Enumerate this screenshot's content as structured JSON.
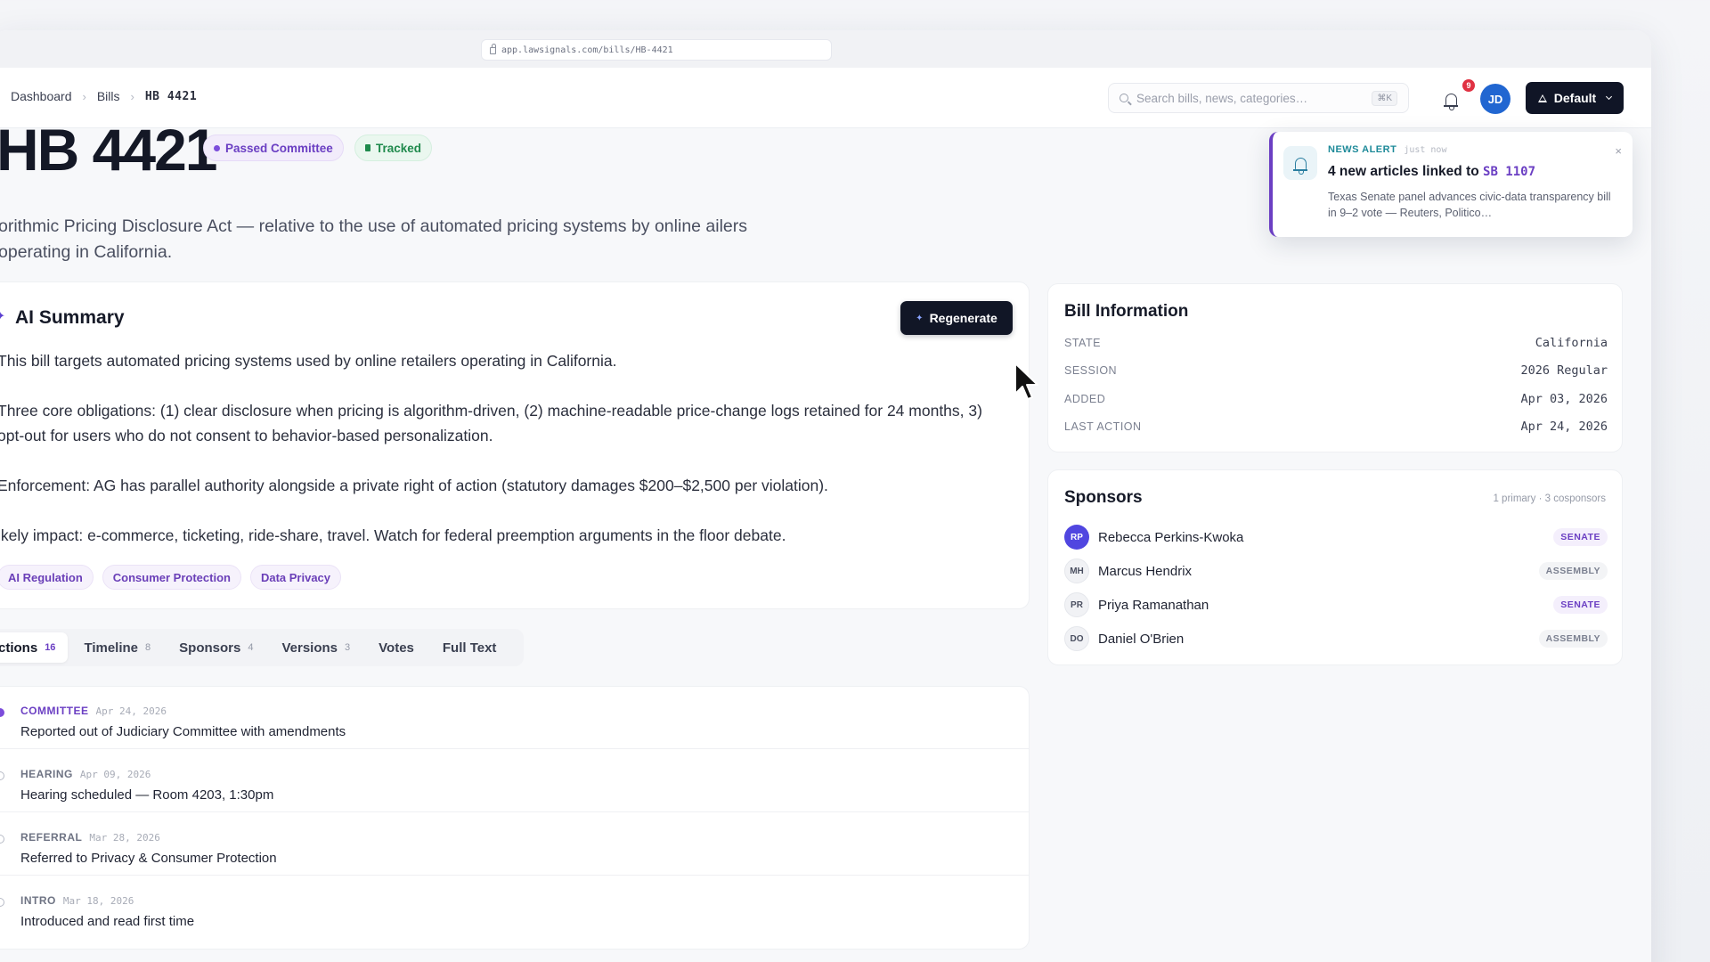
{
  "browser": {
    "url": "app.lawsignals.com/bills/HB-4421"
  },
  "breadcrumb": {
    "items": [
      "Dashboard",
      "Bills",
      "HB 4421"
    ]
  },
  "search": {
    "placeholder": "Search bills, news, categories…",
    "shortcut": "⌘K"
  },
  "notifications": {
    "count": "9"
  },
  "user": {
    "initials": "JD"
  },
  "workspace": {
    "label": "Default"
  },
  "bill": {
    "number": "HB 4421",
    "status": "Passed Committee",
    "tracked": "Tracked",
    "subtitle": "orithmic Pricing Disclosure Act — relative to the use of automated pricing systems by online ailers operating in California."
  },
  "ai_summary": {
    "title": "AI Summary",
    "regenerate_label": "Regenerate",
    "paragraphs": [
      "This bill targets automated pricing systems used by online retailers operating in California.",
      "Three core obligations: (1) clear disclosure when pricing is algorithm-driven, (2) machine-readable price-change logs retained for 24 months, 3) opt-out for users who do not consent to behavior-based personalization.",
      "Enforcement: AG has parallel authority alongside a private right of action (statutory damages $200–$2,500 per violation).",
      "ikely impact: e-commerce, ticketing, ride-share, travel. Watch for federal preemption arguments in the floor debate."
    ],
    "tags": [
      "AI Regulation",
      "Consumer Protection",
      "Data Privacy"
    ]
  },
  "tabs": [
    {
      "label": "ctions",
      "count": "16"
    },
    {
      "label": "Timeline",
      "count": "8"
    },
    {
      "label": "Sponsors",
      "count": "4"
    },
    {
      "label": "Versions",
      "count": "3"
    },
    {
      "label": "Votes",
      "count": ""
    },
    {
      "label": "Full Text",
      "count": ""
    }
  ],
  "timeline": [
    {
      "kind": "COMMITTEE",
      "date": "Apr 24, 2026",
      "text": "Reported out of Judiciary Committee with amendments"
    },
    {
      "kind": "HEARING",
      "date": "Apr 09, 2026",
      "text": "Hearing scheduled — Room 4203, 1:30pm"
    },
    {
      "kind": "REFERRAL",
      "date": "Mar 28, 2026",
      "text": "Referred to Privacy & Consumer Protection"
    },
    {
      "kind": "INTRO",
      "date": "Mar 18, 2026",
      "text": "Introduced and read first time"
    }
  ],
  "bill_info": {
    "title": "Bill Information",
    "rows": [
      {
        "key": "STATE",
        "value": "California"
      },
      {
        "key": "SESSION",
        "value": "2026 Regular"
      },
      {
        "key": "ADDED",
        "value": "Apr 03, 2026"
      },
      {
        "key": "LAST ACTION",
        "value": "Apr 24, 2026"
      }
    ]
  },
  "sponsors": {
    "title": "Sponsors",
    "summary": "1 primary · 3 cosponsors",
    "list": [
      {
        "initials": "RP",
        "name": "Rebecca Perkins-Kwoka",
        "chamber": "SENATE"
      },
      {
        "initials": "MH",
        "name": "Marcus Hendrix",
        "chamber": "ASSEMBLY"
      },
      {
        "initials": "PR",
        "name": "Priya Ramanathan",
        "chamber": "SENATE"
      },
      {
        "initials": "DO",
        "name": "Daniel O'Brien",
        "chamber": "ASSEMBLY"
      }
    ]
  },
  "toast": {
    "kind": "NEWS ALERT",
    "time": "just now",
    "title_prefix": "4 new articles linked to",
    "title_ref": "SB 1107",
    "body": "Texas Senate panel advances civic-data transparency bill in 9–2 vote — Reuters, Politico…",
    "close": "×"
  },
  "colors": {
    "accent": "#6b3fc3",
    "primary_dark": "#101526",
    "avatar_blue": "#2166d1",
    "success": "#1f8a4c"
  }
}
